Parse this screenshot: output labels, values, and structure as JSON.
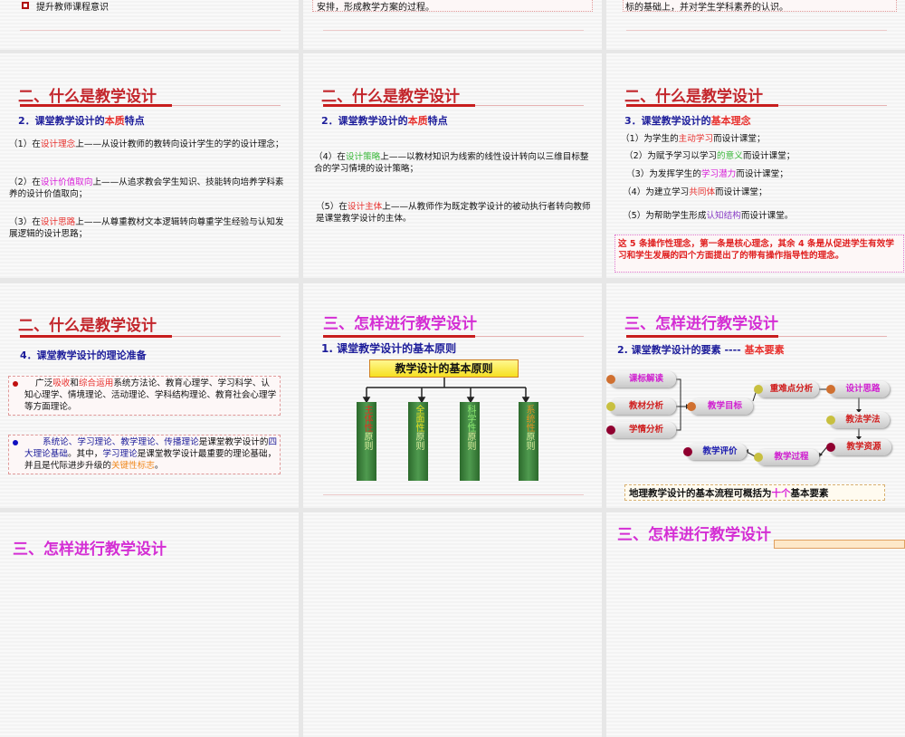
{
  "row0": {
    "left_bullet": "提升教师课程意识",
    "middle_text": "安排，形成教学方案的过程。",
    "right_text": "标的基础上，并对学生学科素养的认识。"
  },
  "s1": {
    "title": "二、什么是教学设计",
    "sub_a": "2．课堂教学设计的",
    "sub_b": "本质",
    "sub_c": "特点",
    "items": [
      {
        "a": "（1）在",
        "h": "设计理念",
        "b": "上——从设计教师的教转向设计学生的学的设计理念；"
      },
      {
        "a": "（2）在",
        "h": "设计价值取向",
        "b": "上——从追求教会学生知识、技能转向培养学科素养的设计价值取向；"
      },
      {
        "a": "（3）在",
        "h": "设计思路",
        "b": "上——从尊重教材文本逻辑转向尊重学生经验与认知发展逻辑的设计思路；"
      }
    ]
  },
  "s2": {
    "title": "二、什么是教学设计",
    "sub_a": "2．课堂教学设计的",
    "sub_b": "本质",
    "sub_c": "特点",
    "items": [
      {
        "a": "（4）在",
        "h": "设计策略",
        "b": "上——以教材知识为线索的线性设计转向以三维目标整合的学习情境的设计策略；"
      },
      {
        "a": "（5）在",
        "h": "设计主体",
        "b": "上——从教师作为既定教学设计的被动执行者转向教师是课堂教学设计的主体。"
      }
    ]
  },
  "s3": {
    "title": "二、什么是教学设计",
    "sub_a": "3．课堂教学设计的",
    "sub_b": "基本理念",
    "items": [
      {
        "a": "（1）为学生的",
        "h": "主动学习",
        "b": "而设计课堂；"
      },
      {
        "a": "（2）为赋予学习以学习",
        "h": "的意义",
        "b": "而设计课堂；"
      },
      {
        "a": "（3）为发挥学生的",
        "h": "学习潜力",
        "b": "而设计课堂；"
      },
      {
        "a": "（4）为建立学习",
        "h": "共同体",
        "b": "而设计课堂；"
      },
      {
        "a": "（5）为帮助学生形成",
        "h": "认知结构",
        "b": "而设计课堂。"
      }
    ],
    "note": "这 5 条操作性理念，第一条是核心理念，其余 4 条是从促进学生有效学习和学生发展的四个方面提出了的带有操作指导性的理念。"
  },
  "s4": {
    "title": "二、什么是教学设计",
    "sub": "4．课堂教学设计的理论准备",
    "p1": {
      "a": "广泛",
      "h1": "吸收",
      "m": "和",
      "h2": "综合运用",
      "b": "系统方法论、教育心理学、学习科学、认知心理学、情境理论、活动理论、学科结构理论、教育社会心理学等方面理论。"
    },
    "p2": {
      "h1": "系统论、学习理论、教学理论、传播理论",
      "a": "是课堂教学设计的",
      "h2": "四大理论基础",
      "b": "。其中，",
      "h3": "学习理论",
      "c": "是课堂教学设计最重要的理论基础，并且是代际进步升级的",
      "h4": "关键性标志",
      "d": "。"
    }
  },
  "s5": {
    "title": "三、怎样进行教学设计",
    "sub": "1. 课堂教学设计的基本原则",
    "root": "教学设计的基本原则",
    "branches": [
      {
        "h": "主体性",
        "b": "原则",
        "color": "#e03020"
      },
      {
        "h": "全面性",
        "b": "原则",
        "color": "#e8e020"
      },
      {
        "h": "科学性",
        "b": "原则",
        "color": "#7ae060"
      },
      {
        "h": "系统性",
        "b": "原则",
        "color": "#e09020"
      }
    ]
  },
  "s6": {
    "title": "三、怎样进行教学设计",
    "sub_a": "2. 课堂教学设计的要素 ---- ",
    "sub_b": "基本要素",
    "nodes": [
      "课标解读",
      "教材分析",
      "学情分析",
      "教学目标",
      "重难点分析",
      "设计思路",
      "教法学法",
      "教学资源",
      "教学过程",
      "教学评价"
    ],
    "note_a": "地理教学设计的基本流程可概括为",
    "note_h": "十个",
    "note_b": "基本要素"
  },
  "row3": {
    "left_title": "三、怎样进行教学设计",
    "right_title": "三、怎样进行教学设计"
  }
}
